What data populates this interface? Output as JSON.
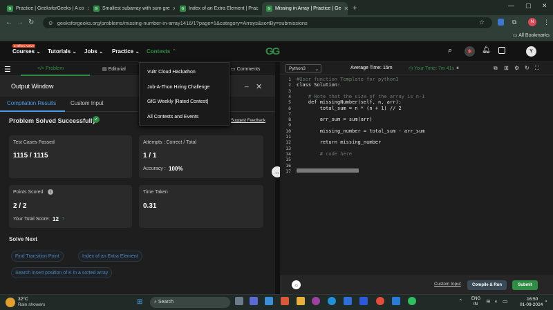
{
  "browser": {
    "tabs": [
      {
        "title": "Practice | GeeksforGeeks | A co",
        "active": false
      },
      {
        "title": "Smallest subarray with sum gre",
        "active": false
      },
      {
        "title": "Index of an Extra Element | Prac",
        "active": false
      },
      {
        "title": "Missing in Array | Practice | Ge",
        "active": true
      }
    ],
    "new_tab": "+",
    "url": "geeksforgeeks.org/problems/missing-number-in-array1416/1?page=1&category=Arrays&sortBy=submissions",
    "bookmarks": "All Bookmarks",
    "profile_letter": "N"
  },
  "nav": {
    "badge": "2 Offers Active",
    "courses": "Courses",
    "tutorials": "Tutorials",
    "jobs": "Jobs",
    "practice": "Practice",
    "contests": "Contests",
    "logo": "GG",
    "avatar": "Y"
  },
  "dropdown": [
    "Vultr Cloud Hackathon",
    "Job-A-Thon Hiring Challenge",
    "GfG Weekly [Rated Contest]",
    "All Contests and Events"
  ],
  "panel_tabs": {
    "problem": "Problem",
    "editorial": "Editorial",
    "comments": "Comments"
  },
  "output": {
    "title": "Output Window",
    "tab_results": "Compilation Results",
    "tab_custom": "Custom Input",
    "status": "Problem Solved Successfully",
    "feedback": "Suggest Feedback",
    "tests_label": "Test Cases Passed",
    "tests_value": "1115 / 1115",
    "attempts_label": "Attempts : Correct / Total",
    "attempts_value": "1 / 1",
    "accuracy_label": "Accuracy :",
    "accuracy_value": "100%",
    "points_label": "Points Scored",
    "points_value": "2 / 2",
    "score_label": "Your Total Score:",
    "score_value": "12",
    "time_label": "Time Taken",
    "time_value": "0.31",
    "solve_next": "Solve Next",
    "next": [
      "Find Transition Point",
      "Index of an Extra Element",
      "Search insert position of K in a sorted array"
    ]
  },
  "editor": {
    "language": "Python3",
    "avg_time": "Average Time: 15m",
    "your_time": "Your Time: 7m 41s",
    "lines": [
      "#User function Template for python3",
      "class Solution:",
      "",
      "    # Note that the size of the array is n-1",
      "    def missingNumber(self, n, arr):",
      "        total_sum = n * (n + 1) // 2",
      "",
      "        arr_sum = sum(arr)",
      "",
      "        missing_number = total_sum - arr_sum",
      "",
      "        return missing_number",
      "",
      "        # code here",
      "",
      "",
      ""
    ],
    "custom_input": "Custom Input",
    "compile_run": "Compile & Run",
    "submit": "Submit"
  },
  "taskbar": {
    "temp": "32°C",
    "weather": "Rain showers",
    "search": "Search",
    "lang1": "ENG",
    "lang2": "IN",
    "time": "16:50",
    "date": "01-09-2024"
  }
}
